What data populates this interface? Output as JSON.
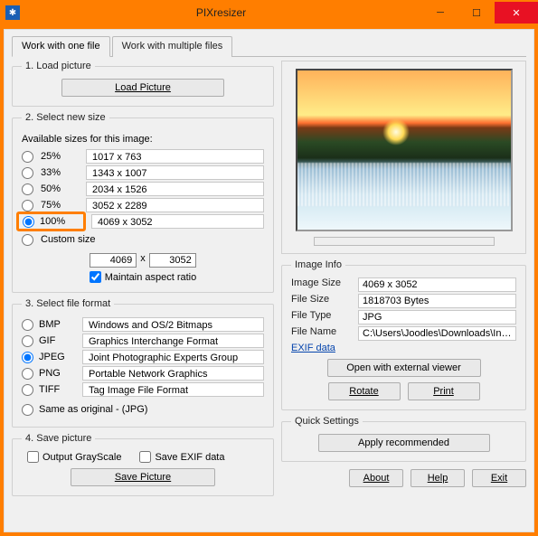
{
  "window": {
    "title": "PIXresizer"
  },
  "tabs": {
    "active": "Work with one file",
    "inactive": "Work with multiple files"
  },
  "load": {
    "legend": "1. Load picture",
    "button": "Load Picture"
  },
  "size": {
    "legend": "2. Select new size",
    "available": "Available sizes for this image:",
    "rows": [
      {
        "pct": "25%",
        "dim": "1017  x  763"
      },
      {
        "pct": "33%",
        "dim": "1343  x  1007"
      },
      {
        "pct": "50%",
        "dim": "2034  x  1526"
      },
      {
        "pct": "75%",
        "dim": "3052  x  2289"
      },
      {
        "pct": "100%",
        "dim": "4069  x  3052"
      }
    ],
    "custom": "Custom size",
    "w": "4069",
    "x": "x",
    "h": "3052",
    "maintain": "Maintain aspect ratio",
    "selected": 4
  },
  "format": {
    "legend": "3. Select file format",
    "rows": [
      {
        "code": "BMP",
        "desc": "Windows and OS/2 Bitmaps"
      },
      {
        "code": "GIF",
        "desc": "Graphics Interchange Format"
      },
      {
        "code": "JPEG",
        "desc": "Joint Photographic Experts Group"
      },
      {
        "code": "PNG",
        "desc": "Portable Network Graphics"
      },
      {
        "code": "TIFF",
        "desc": "Tag Image File Format"
      }
    ],
    "same": "Same as original  - (JPG)",
    "selected": 2
  },
  "save": {
    "legend": "4. Save picture",
    "gray": "Output GrayScale",
    "exif": "Save EXIF data",
    "button": "Save Picture"
  },
  "info": {
    "legend": "Image Info",
    "k_size": "Image Size",
    "v_size": "4069 x 3052",
    "k_fsize": "File Size",
    "v_fsize": "1818703 Bytes",
    "k_ftype": "File Type",
    "v_ftype": "JPG",
    "k_fname": "File Name",
    "v_fname": "C:\\Users\\Joodles\\Downloads\\Increa",
    "exif": "EXIF data",
    "open": "Open with external viewer",
    "rotate": "Rotate",
    "print": "Print"
  },
  "quick": {
    "legend": "Quick Settings",
    "apply": "Apply recommended"
  },
  "footer": {
    "about": "About",
    "help": "Help",
    "exit": "Exit"
  }
}
